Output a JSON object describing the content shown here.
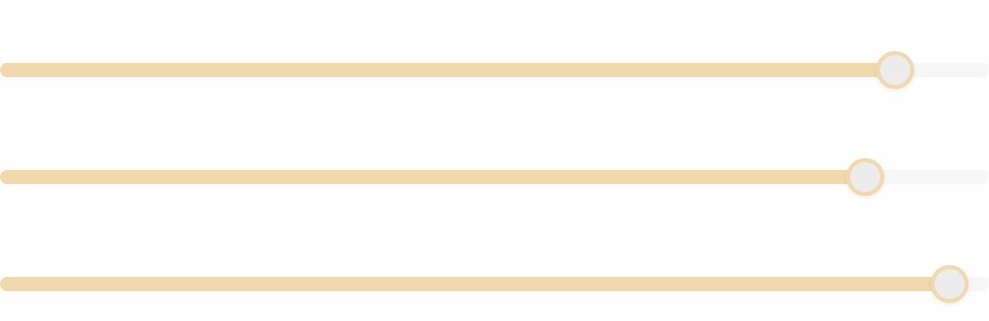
{
  "colors": {
    "background": "#fefefe",
    "track": "#f6f6f6",
    "fill": "#f1d9ad",
    "thumb_fill": "#ececec",
    "thumb_border": "#f1d9ad"
  },
  "sliders": [
    {
      "value": 0.905
    },
    {
      "value": 0.875
    },
    {
      "value": 0.96
    }
  ]
}
